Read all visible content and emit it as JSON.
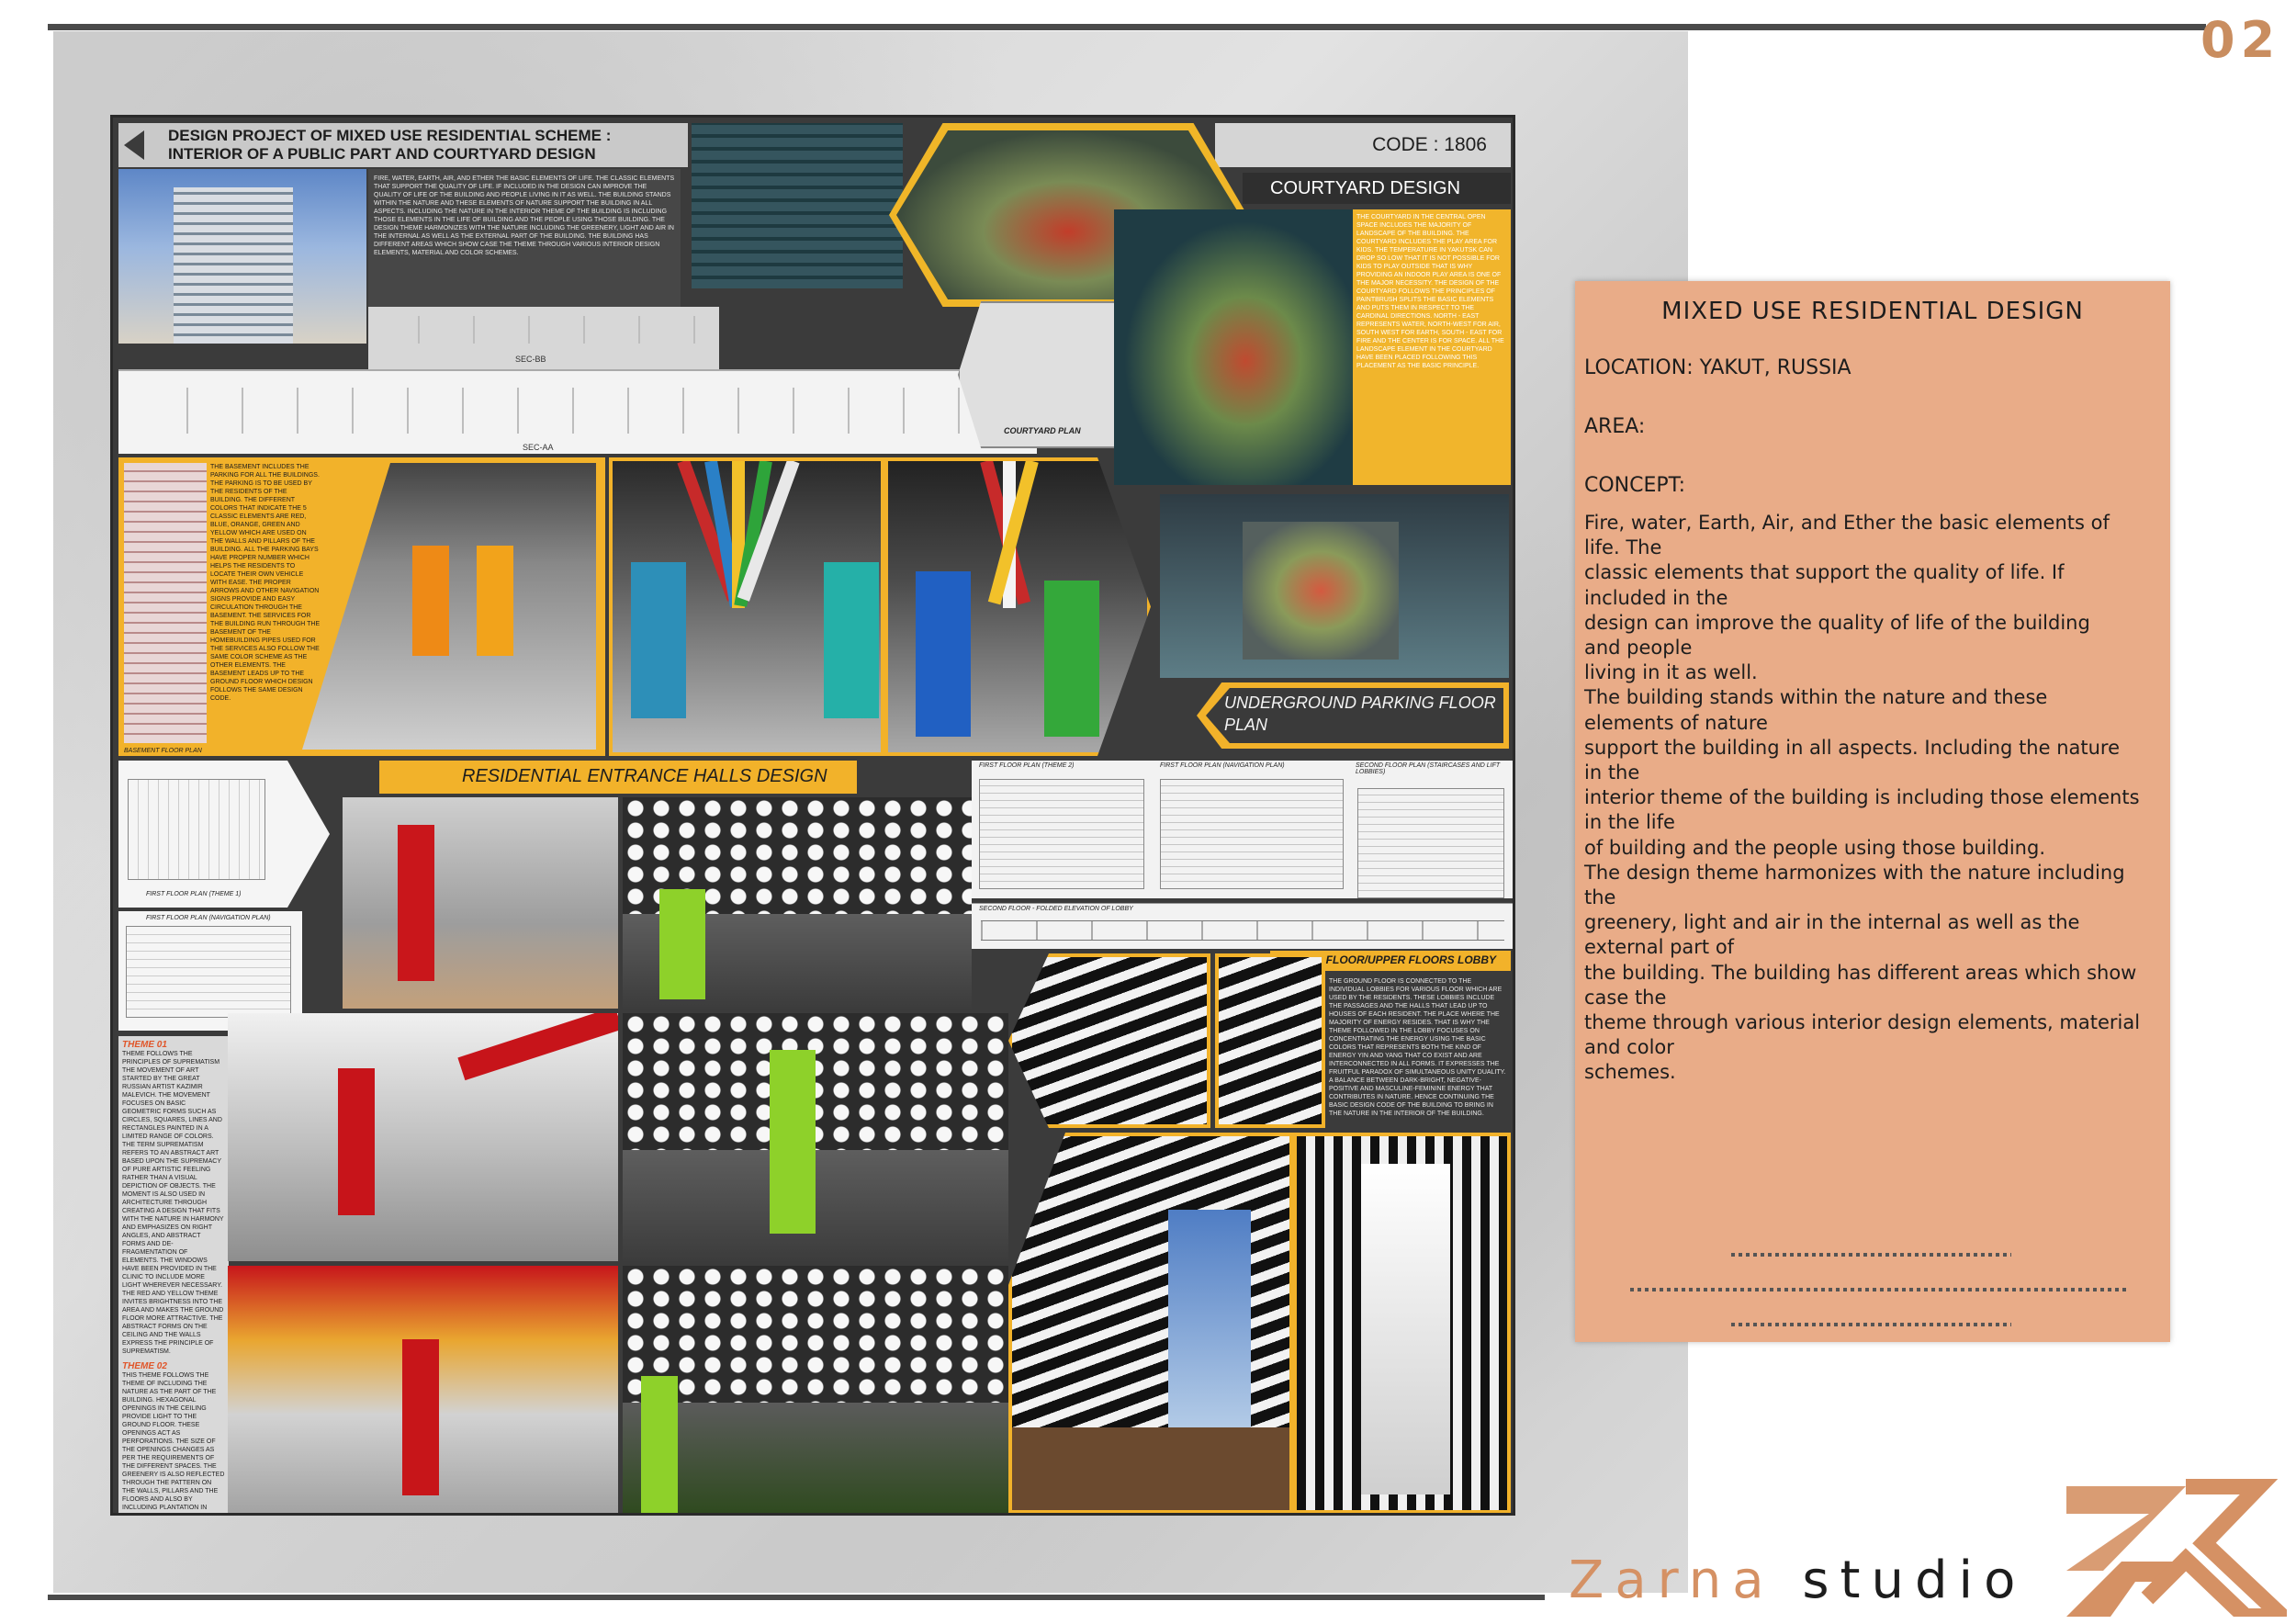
{
  "page": {
    "number": "02"
  },
  "poster": {
    "title_line1": "DESIGN PROJECT OF MIXED USE RESIDENTIAL SCHEME :",
    "title_line2": "INTERIOR OF A PUBLIC PART AND COURTYARD DESIGN",
    "code": "CODE : 1806",
    "courtyard_heading": "COURTYARD DESIGN",
    "courtyard_plan_label": "COURTYARD PLAN",
    "sec_bb": "SEC-BB",
    "sec_aa": "SEC-AA",
    "underground_label": "UNDERGROUND PARKING FLOOR PLAN",
    "basement_label": "BASEMENT FLOOR PLAN",
    "entrance_heading": "RESIDENTIAL ENTRANCE HALLS DESIGN",
    "first_floor_theme1": "FIRST FLOOR PLAN (THEME 1)",
    "first_floor_nav": "FIRST FLOOR PLAN (NAVIGATION PLAN)",
    "first_floor_theme2": "FIRST FLOOR PLAN (THEME 2)",
    "first_floor_nav2": "FIRST FLOOR PLAN (NAVIGATION PLAN)",
    "second_floor_stairs": "SECOND FLOOR PLAN (STAIRCASES AND LIFT LOBBIES)",
    "second_floor_elev": "SECOND FLOOR - FOLDED ELEVATION OF LOBBY",
    "lobby_heading": "SECOND FLOOR/UPPER FLOORS LOBBY",
    "theme1_label": "THEME 01",
    "theme2_label": "THEME 02",
    "intro_text": "FIRE, WATER, EARTH, AIR, AND ETHER THE BASIC ELEMENTS OF LIFE. THE CLASSIC ELEMENTS THAT SUPPORT THE QUALITY OF LIFE. IF INCLUDED IN THE DESIGN CAN IMPROVE THE QUALITY OF LIFE OF THE BUILDING AND PEOPLE LIVING IN IT AS WELL. THE BUILDING STANDS WITHIN THE NATURE AND THESE ELEMENTS OF NATURE SUPPORT THE BUILDING IN ALL ASPECTS. INCLUDING THE NATURE IN THE INTERIOR THEME OF THE BUILDING IS INCLUDING THOSE ELEMENTS IN THE LIFE OF BUILDING AND THE PEOPLE USING THOSE BUILDING. THE DESIGN THEME HARMONIZES WITH THE NATURE INCLUDING THE GREENERY, LIGHT AND AIR IN THE INTERNAL AS WELL AS THE EXTERNAL PART OF THE BUILDING. THE BUILDING HAS DIFFERENT AREAS WHICH SHOW CASE THE THEME THROUGH VARIOUS INTERIOR DESIGN ELEMENTS, MATERIAL AND COLOR SCHEMES.",
    "courtyard_text": "THE COURTYARD IN THE CENTRAL OPEN SPACE INCLUDES THE MAJORITY OF LANDSCAPE OF THE BUILDING. THE COURTYARD INCLUDES THE PLAY AREA FOR KIDS. THE TEMPERATURE IN YAKUTSK CAN DROP SO LOW THAT IT IS NOT POSSIBLE FOR KIDS TO PLAY OUTSIDE THAT IS WHY PROVIDING AN INDOOR PLAY AREA IS ONE OF THE MAJOR NECESSITY. THE DESIGN OF THE COURTYARD FOLLOWS THE PRINCIPLES OF PAINTBRUSH SPLITS THE BASIC ELEMENTS AND PUTS THEM IN RESPECT TO THE CARDINAL DIRECTIONS. NORTH - EAST REPRESENTS WATER, NORTH-WEST FOR AIR, SOUTH WEST FOR EARTH, SOUTH - EAST FOR FIRE AND THE CENTER IS FOR SPACE. ALL THE LANDSCAPE ELEMENT IN THE COURTYARD HAVE BEEN PLACED FOLLOWING THIS PLACEMENT AS THE BASIC PRINCIPLE.",
    "basement_text": "THE BASEMENT INCLUDES THE PARKING FOR ALL THE BUILDINGS. THE PARKING IS TO BE USED BY THE RESIDENTS OF THE BUILDING. THE DIFFERENT COLORS THAT INDICATE THE 5 CLASSIC ELEMENTS ARE RED, BLUE, ORANGE, GREEN AND YELLOW WHICH ARE USED ON THE WALLS AND PILLARS OF THE BUILDING. ALL THE PARKING BAYS HAVE PROPER NUMBER WHICH HELPS THE RESIDENTS TO LOCATE THEIR OWN VEHICLE WITH EASE. THE PROPER ARROWS AND OTHER NAVIGATION SIGNS PROVIDE AND EASY CIRCULATION THROUGH THE BASEMENT. THE SERVICES FOR THE BUILDING RUN THROUGH THE BASEMENT OF THE HOMEBUILDING PIPES USED FOR THE SERVICES ALSO FOLLOW THE SAME COLOR SCHEME AS THE OTHER ELEMENTS. THE BASEMENT LEADS UP TO THE GROUND FLOOR WHICH DESIGN FOLLOWS THE SAME DESIGN CODE.",
    "theme1_text": "THEME FOLLOWS THE PRINCIPLES OF SUPREMATISM THE MOVEMENT OF ART STARTED BY THE GREAT RUSSIAN ARTIST KAZIMIR MALEVICH. THE MOVEMENT FOCUSES ON BASIC GEOMETRIC FORMS SUCH AS CIRCLES, SQUARES, LINES AND RECTANGLES PAINTED IN A LIMITED RANGE OF COLORS. THE TERM SUPREMATISM REFERS TO AN ABSTRACT ART BASED UPON THE SUPREMACY OF PURE ARTISTIC FEELING RATHER THAN A VISUAL DEPICTION OF OBJECTS. THE MOMENT IS ALSO USED IN ARCHITECTURE THROUGH CREATING A DESIGN THAT FITS WITH THE NATURE IN HARMONY AND EMPHASIZES ON RIGHT ANGLES, AND ABSTRACT FORMS AND DE-FRAGMENTATION OF ELEMENTS. THE WINDOWS HAVE BEEN PROVIDED IN THE CLINIC TO INCLUDE MORE LIGHT WHEREVER NECESSARY. THE RED AND YELLOW THEME INVITES BRIGHTNESS INTO THE AREA AND MAKES THE GROUND FLOOR MORE ATTRACTIVE. THE ABSTRACT FORMS ON THE CEILING AND THE WALLS EXPRESS THE PRINCIPLE OF SUPREMATISM.",
    "theme2_text": "THIS THEME FOLLOWS THE THEME OF INCLUDING THE NATURE AS THE PART OF THE BUILDING. HEXAGONAL OPENINGS IN THE CEILING PROVIDE LIGHT TO THE GROUND FLOOR. THESE OPENINGS ACT AS PERFORATIONS. THE SIZE OF THE OPENINGS CHANGES AS PER THE REQUIREMENTS OF THE DIFFERENT SPACES. THE GREENERY IS ALSO REFLECTED THROUGH THE PATTERN ON THE WALLS, PILLARS AND THE FLOORS AND ALSO BY INCLUDING PLANTATION IN DIFFERENT SPACES.",
    "lobby_text": "THE GROUND FLOOR IS CONNECTED TO THE INDIVIDUAL LOBBIES FOR VARIOUS FLOOR WHICH ARE USED BY THE RESIDENTS. THESE LOBBIES INCLUDE THE PASSAGES AND THE HALLS THAT LEAD UP TO HOUSES OF EACH RESIDENT. THE PLACE WHERE THE MAJORITY OF ENERGY RESIDES. THAT IS WHY THE THEME FOLLOWED IN THE LOBBY FOCUSES ON CONCENTRATING THE ENERGY USING THE BASIC COLORS THAT REPRESENTS BOTH THE KIND OF ENERGY YIN AND YANG THAT CO EXIST AND ARE INTERCONNECTED IN ALL FORMS. IT EXPRESSES THE FRUITFUL PARADOX OF SIMULTANEOUS UNITY DUALITY. A BALANCE BETWEEN DARK-BRIGHT, NEGATIVE-POSITIVE AND MASCULINE-FEMININE ENERGY THAT CONTRIBUTES IN NATURE. HENCE CONTINUING THE BASIC DESIGN CODE OF THE BUILDING TO BRING IN THE NATURE IN THE INTERIOR OF THE BUILDING."
  },
  "card": {
    "title": "MIXED USE RESIDENTIAL DESIGN",
    "location": "LOCATION: YAKUT, RUSSIA",
    "area": "AREA:",
    "concept": "CONCEPT:",
    "lines": [
      "Fire, water, Earth, Air, and Ether the basic elements of",
      "life. The",
      "classic elements that support the quality of life. If",
      "included in the",
      "design can improve the quality of life of the building",
      "and people",
      "living in it as well.",
      "The building stands within the nature and these",
      "elements of nature",
      "support the building in all aspects. Including the nature",
      "in the",
      "interior theme of the building is including those elements",
      "in the life",
      "of building and the people using those building.",
      "The design theme harmonizes with the nature including",
      "the",
      "greenery, light and air in the internal as well as the",
      "external part of",
      "the building. The building has different areas which show",
      "case the",
      "theme through various interior design elements, material",
      "and color",
      "schemes."
    ]
  },
  "brand": {
    "name_a": "Zarna",
    "name_b": "studio"
  },
  "colors": {
    "accent": "#f2b22a",
    "card": "#e9ac88",
    "brand": "#d59164",
    "dark": "#3b3b3b"
  }
}
